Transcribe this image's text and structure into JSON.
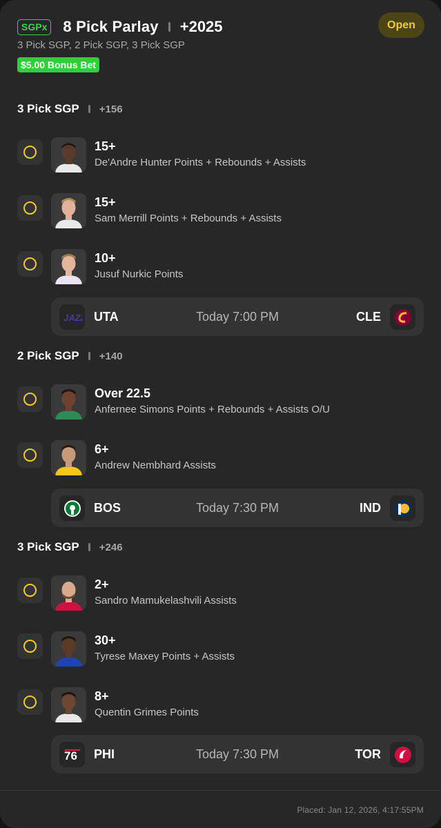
{
  "header": {
    "badge": "SGPx",
    "title": "8 Pick Parlay",
    "odds": "+2025",
    "status": "Open",
    "subtitle": "3 Pick SGP, 2 Pick SGP, 3 Pick SGP",
    "bonus": "$5.00 Bonus Bet"
  },
  "sections": [
    {
      "title": "3 Pick SGP",
      "odds": "+156",
      "legs": [
        {
          "line": "15+",
          "desc": "De'Andre Hunter Points + Rebounds + Assists",
          "skin": "#5a3a2a",
          "jersey": "#e8e8e8"
        },
        {
          "line": "15+",
          "desc": "Sam Merrill Points + Rebounds + Assists",
          "skin": "#e0b49a",
          "jersey": "#e8e8e8"
        },
        {
          "line": "10+",
          "desc": "Jusuf Nurkic Points",
          "skin": "#e3b69c",
          "jersey": "#e8e4f0"
        }
      ],
      "game": {
        "away": "UTA",
        "home": "CLE",
        "time": "Today 7:00 PM"
      }
    },
    {
      "title": "2 Pick SGP",
      "odds": "+140",
      "legs": [
        {
          "line": "Over 22.5",
          "desc": "Anfernee Simons Points + Rebounds + Assists O/U",
          "skin": "#6b4330",
          "jersey": "#2e8b57"
        },
        {
          "line": "6+",
          "desc": "Andrew Nembhard Assists",
          "skin": "#c79a7a",
          "jersey": "#f5c518"
        }
      ],
      "game": {
        "away": "BOS",
        "home": "IND",
        "time": "Today 7:30 PM"
      }
    },
    {
      "title": "3 Pick SGP",
      "odds": "+246",
      "legs": [
        {
          "line": "2+",
          "desc": "Sandro Mamukelashvili Assists",
          "skin": "#d9a98c",
          "jersey": "#ce1141"
        },
        {
          "line": "30+",
          "desc": "Tyrese Maxey Points + Assists",
          "skin": "#5b3a28",
          "jersey": "#1d42ba"
        },
        {
          "line": "8+",
          "desc": "Quentin Grimes Points",
          "skin": "#6e4732",
          "jersey": "#e8e8e8"
        }
      ],
      "game": {
        "away": "PHI",
        "home": "TOR",
        "time": "Today 7:30 PM"
      }
    }
  ],
  "footer": {
    "placed": "Placed: Jan 12, 2026, 4:17:55PM"
  },
  "colors": {
    "accent_yellow": "#f4cb2a",
    "bonus_green": "#2fcf3c",
    "card_bg": "#272727"
  }
}
